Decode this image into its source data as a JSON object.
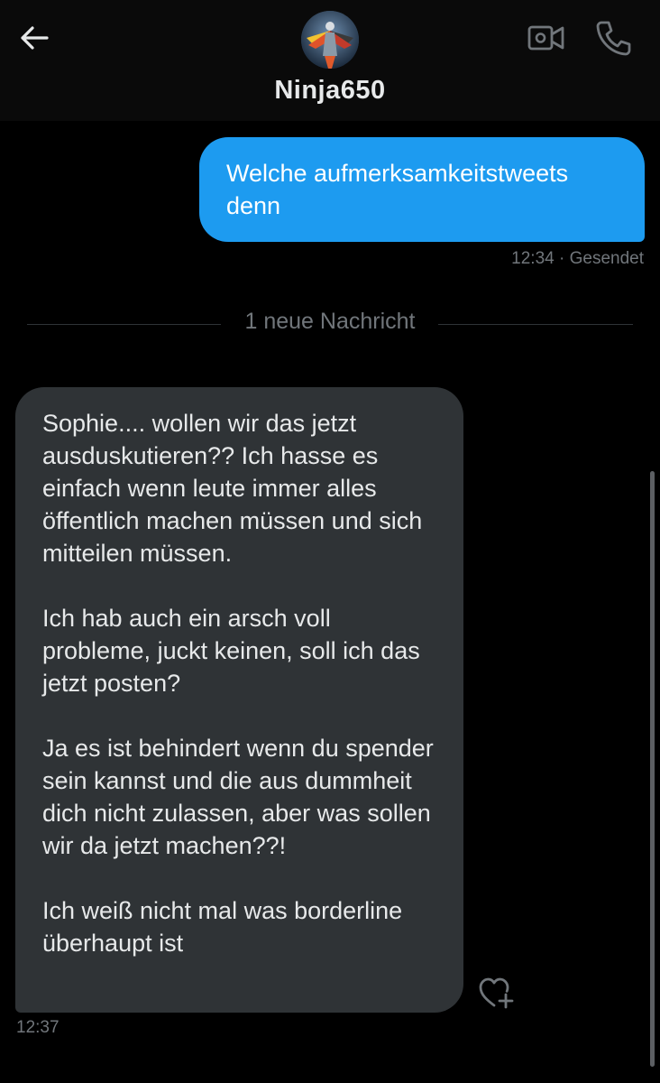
{
  "header": {
    "back_icon": "arrow-left-icon",
    "contact_name": "Ninja650",
    "video_icon": "video-camera-icon",
    "call_icon": "phone-icon"
  },
  "messages": {
    "sent": {
      "text": "Welche aufmerksamkeitstweets denn",
      "time": "12:34",
      "status": "· Gesendet"
    },
    "new_divider": "1 neue Nachricht",
    "received": {
      "paragraphs": [
        "Sophie.... wollen wir das jetzt ausduskutieren?? Ich hasse es einfach wenn leute immer alles öffentlich machen müssen und sich mitteilen müssen.",
        "Ich hab auch ein arsch voll probleme, juckt keinen, soll ich das jetzt posten?",
        "Ja es ist behindert wenn du spender sein kannst und die aus dummheit dich nicht zulassen, aber was sollen wir da jetzt machen??!",
        "Ich weiß nicht mal was borderline überhaupt ist"
      ],
      "time": "12:37",
      "reaction_icon": "heart-plus-icon"
    }
  },
  "colors": {
    "accent": "#1d9bf0",
    "background": "#000000",
    "received_bubble": "#2f3336",
    "muted_text": "#71767b"
  }
}
